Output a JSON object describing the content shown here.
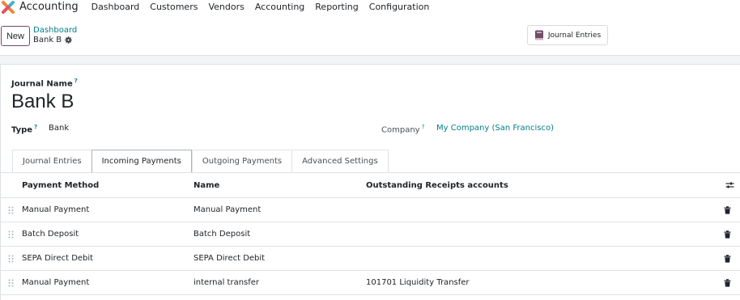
{
  "nav": {
    "app_name": "Accounting",
    "menu": [
      "Dashboard",
      "Customers",
      "Vendors",
      "Accounting",
      "Reporting",
      "Configuration"
    ]
  },
  "control": {
    "new_label": "New",
    "breadcrumb_parent": "Dashboard",
    "breadcrumb_current": "Bank B",
    "smart_button_label": "Journal Entries"
  },
  "form": {
    "journal_name_label": "Journal Name",
    "help_mark": "?",
    "title": "Bank B",
    "type_label": "Type",
    "type_value": "Bank",
    "company_label": "Company",
    "company_value": "My Company (San Francisco)"
  },
  "tabs": [
    "Journal Entries",
    "Incoming Payments",
    "Outgoing Payments",
    "Advanced Settings"
  ],
  "active_tab": "Incoming Payments",
  "table": {
    "headers": [
      "Payment Method",
      "Name",
      "Outstanding Receipts accounts"
    ],
    "rows": [
      {
        "method": "Manual Payment",
        "name": "Manual Payment",
        "account": ""
      },
      {
        "method": "Batch Deposit",
        "name": "Batch Deposit",
        "account": ""
      },
      {
        "method": "SEPA Direct Debit",
        "name": "SEPA Direct Debit",
        "account": ""
      },
      {
        "method": "Manual Payment",
        "name": "internal transfer",
        "account": "101701 Liquidity Transfer"
      }
    ]
  },
  "colors": {
    "brand": "#714b67",
    "link": "#017e84",
    "border": "#dee2e6"
  }
}
